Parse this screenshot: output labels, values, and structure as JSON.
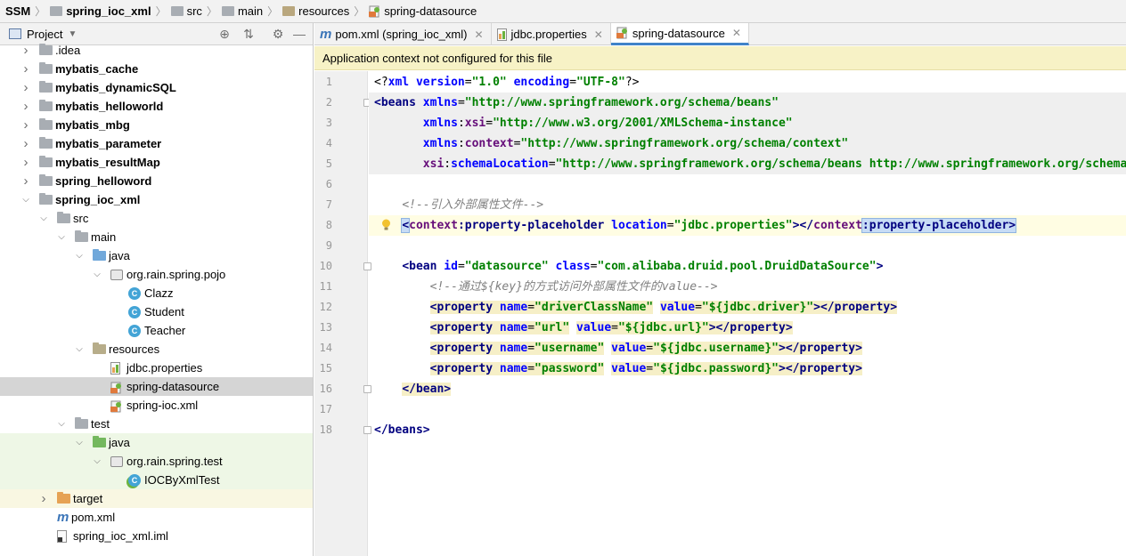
{
  "breadcrumb": {
    "items": [
      "SSM",
      "spring_ioc_xml",
      "src",
      "main",
      "resources",
      "spring-datasource"
    ]
  },
  "project_panel": {
    "title": "Project",
    "header_icons": [
      "target-icon",
      "collapse-icon",
      "gear-icon",
      "minimize-icon"
    ],
    "tree": [
      {
        "label": ".idea",
        "level": 1,
        "arrow": "collapsed",
        "icon": "folder",
        "bold": false
      },
      {
        "label": "mybatis_cache",
        "level": 1,
        "arrow": "collapsed",
        "icon": "module-folder",
        "bold": true
      },
      {
        "label": "mybatis_dynamicSQL",
        "level": 1,
        "arrow": "collapsed",
        "icon": "module-folder",
        "bold": true
      },
      {
        "label": "mybatis_helloworld",
        "level": 1,
        "arrow": "collapsed",
        "icon": "module-folder",
        "bold": true
      },
      {
        "label": "mybatis_mbg",
        "level": 1,
        "arrow": "collapsed",
        "icon": "module-folder",
        "bold": true
      },
      {
        "label": "mybatis_parameter",
        "level": 1,
        "arrow": "collapsed",
        "icon": "module-folder",
        "bold": true
      },
      {
        "label": "mybatis_resultMap",
        "level": 1,
        "arrow": "collapsed",
        "icon": "module-folder",
        "bold": true
      },
      {
        "label": "spring_helloword",
        "level": 1,
        "arrow": "collapsed",
        "icon": "module-folder",
        "bold": true
      },
      {
        "label": "spring_ioc_xml",
        "level": 1,
        "arrow": "expanded",
        "icon": "module-folder",
        "bold": true
      },
      {
        "label": "src",
        "level": 2,
        "arrow": "expanded",
        "icon": "folder",
        "bold": false
      },
      {
        "label": "main",
        "level": 3,
        "arrow": "expanded",
        "icon": "folder",
        "bold": false
      },
      {
        "label": "java",
        "level": 4,
        "arrow": "expanded",
        "icon": "source-folder",
        "bold": false
      },
      {
        "label": "org.rain.spring.pojo",
        "level": 5,
        "arrow": "expanded",
        "icon": "package",
        "bold": false
      },
      {
        "label": "Clazz",
        "level": 6,
        "arrow": "none",
        "icon": "class",
        "bold": false
      },
      {
        "label": "Student",
        "level": 6,
        "arrow": "none",
        "icon": "class",
        "bold": false
      },
      {
        "label": "Teacher",
        "level": 6,
        "arrow": "none",
        "icon": "class",
        "bold": false
      },
      {
        "label": "resources",
        "level": 4,
        "arrow": "expanded",
        "icon": "resources-folder",
        "bold": false
      },
      {
        "label": "jdbc.properties",
        "level": 5,
        "arrow": "none",
        "icon": "properties-file",
        "bold": false
      },
      {
        "label": "spring-datasource",
        "level": 5,
        "arrow": "none",
        "icon": "spring-xml",
        "bold": false,
        "selected": true
      },
      {
        "label": "spring-ioc.xml",
        "level": 5,
        "arrow": "none",
        "icon": "spring-xml",
        "bold": false
      },
      {
        "label": "test",
        "level": 3,
        "arrow": "expanded",
        "icon": "folder",
        "bold": false
      },
      {
        "label": "java",
        "level": 4,
        "arrow": "expanded",
        "icon": "test-folder",
        "bold": false,
        "test": true
      },
      {
        "label": "org.rain.spring.test",
        "level": 5,
        "arrow": "expanded",
        "icon": "package",
        "bold": false,
        "test": true
      },
      {
        "label": "IOCByXmlTest",
        "level": 6,
        "arrow": "none",
        "icon": "test-class",
        "bold": false,
        "test": true
      },
      {
        "label": "target",
        "level": 2,
        "arrow": "collapsed",
        "icon": "excluded-folder",
        "bold": false,
        "target": true
      },
      {
        "label": "pom.xml",
        "level": 2,
        "arrow": "none",
        "icon": "maven",
        "bold": false
      },
      {
        "label": "spring_ioc_xml.iml",
        "level": 2,
        "arrow": "none",
        "icon": "iml-file",
        "bold": false
      }
    ]
  },
  "editor": {
    "tabs": [
      {
        "label": "pom.xml (spring_ioc_xml)",
        "icon": "maven-icon",
        "active": false
      },
      {
        "label": "jdbc.properties",
        "icon": "properties-file-icon",
        "active": false
      },
      {
        "label": "spring-datasource",
        "icon": "spring-xml-icon",
        "active": true
      }
    ],
    "banner": "Application context not configured for this file",
    "line_numbers": [
      "1",
      "2",
      "3",
      "4",
      "5",
      "6",
      "7",
      "8",
      "9",
      "10",
      "11",
      "12",
      "13",
      "14",
      "15",
      "16",
      "17",
      "18"
    ],
    "lines": [
      [
        [
          "plain",
          "<?"
        ],
        [
          "attr",
          "xml "
        ],
        [
          "attr",
          "version"
        ],
        [
          "plain",
          "="
        ],
        [
          "val",
          "\"1.0\""
        ],
        [
          "plain",
          " "
        ],
        [
          "attr",
          "encoding"
        ],
        [
          "plain",
          "="
        ],
        [
          "val",
          "\"UTF-8\""
        ],
        [
          "plain",
          "?>"
        ]
      ],
      [
        [
          "tag",
          "<beans "
        ],
        [
          "attr",
          "xmlns"
        ],
        [
          "plain",
          "="
        ],
        [
          "val",
          "\"http://www.springframework.org/schema/beans\""
        ]
      ],
      [
        [
          "plain",
          "       "
        ],
        [
          "attr",
          "xmlns"
        ],
        [
          "plain",
          ":"
        ],
        [
          "ns",
          "xsi"
        ],
        [
          "plain",
          "="
        ],
        [
          "val",
          "\"http://www.w3.org/2001/XMLSchema-instance\""
        ]
      ],
      [
        [
          "plain",
          "       "
        ],
        [
          "attr",
          "xmlns"
        ],
        [
          "plain",
          ":"
        ],
        [
          "ns",
          "context"
        ],
        [
          "plain",
          "="
        ],
        [
          "val",
          "\"http://www.springframework.org/schema/context\""
        ]
      ],
      [
        [
          "plain",
          "       "
        ],
        [
          "ns",
          "xsi"
        ],
        [
          "plain",
          ":"
        ],
        [
          "attr",
          "schemaLocation"
        ],
        [
          "plain",
          "="
        ],
        [
          "val",
          "\"http://www.springframework.org/schema/beans http://www.springframework.org/schema/beans/spring-beans.xsd\""
        ]
      ],
      [],
      [
        [
          "plain",
          "    "
        ],
        [
          "cmt",
          "<!--引入外部属性文件-->"
        ]
      ],
      [
        [
          "plain",
          "    "
        ],
        [
          "tag",
          "<"
        ],
        [
          "ns",
          "context"
        ],
        [
          "tag",
          ":property-placeholder "
        ],
        [
          "attr",
          "location"
        ],
        [
          "plain",
          "="
        ],
        [
          "val",
          "\"jdbc.properties\""
        ],
        [
          "tag",
          "></"
        ],
        [
          "ns",
          "context"
        ],
        [
          "tag",
          ":property-placeholder>"
        ]
      ],
      [],
      [
        [
          "plain",
          "    "
        ],
        [
          "tag",
          "<bean "
        ],
        [
          "attr",
          "id"
        ],
        [
          "plain",
          "="
        ],
        [
          "val",
          "\"datasource\""
        ],
        [
          "plain",
          " "
        ],
        [
          "attr",
          "class"
        ],
        [
          "plain",
          "="
        ],
        [
          "val",
          "\"com.alibaba.druid.pool.DruidDataSource\""
        ],
        [
          "tag",
          ">"
        ]
      ],
      [
        [
          "plain",
          "        "
        ],
        [
          "cmt",
          "<!--通过${key}的方式访问外部属性文件的value-->"
        ]
      ],
      [
        [
          "plain",
          "        "
        ],
        [
          "tag",
          "<property "
        ],
        [
          "attr",
          "name"
        ],
        [
          "plain",
          "="
        ],
        [
          "val",
          "\"driverClassName\""
        ],
        [
          "plain",
          " "
        ],
        [
          "attr",
          "value"
        ],
        [
          "plain",
          "="
        ],
        [
          "val",
          "\"${jdbc.driver}\""
        ],
        [
          "tag",
          "></property>"
        ]
      ],
      [
        [
          "plain",
          "        "
        ],
        [
          "tag",
          "<property "
        ],
        [
          "attr",
          "name"
        ],
        [
          "plain",
          "="
        ],
        [
          "val",
          "\"url\""
        ],
        [
          "plain",
          " "
        ],
        [
          "attr",
          "value"
        ],
        [
          "plain",
          "="
        ],
        [
          "val",
          "\"${jdbc.url}\""
        ],
        [
          "tag",
          "></property>"
        ]
      ],
      [
        [
          "plain",
          "        "
        ],
        [
          "tag",
          "<property "
        ],
        [
          "attr",
          "name"
        ],
        [
          "plain",
          "="
        ],
        [
          "val",
          "\"username\""
        ],
        [
          "plain",
          " "
        ],
        [
          "attr",
          "value"
        ],
        [
          "plain",
          "="
        ],
        [
          "val",
          "\"${jdbc.username}\""
        ],
        [
          "tag",
          "></property>"
        ]
      ],
      [
        [
          "plain",
          "        "
        ],
        [
          "tag",
          "<property "
        ],
        [
          "attr",
          "name"
        ],
        [
          "plain",
          "="
        ],
        [
          "val",
          "\"password\""
        ],
        [
          "plain",
          " "
        ],
        [
          "attr",
          "value"
        ],
        [
          "plain",
          "="
        ],
        [
          "val",
          "\"${jdbc.password}\""
        ],
        [
          "tag",
          "></property>"
        ]
      ],
      [
        [
          "plain",
          "    "
        ],
        [
          "tag",
          "</bean>"
        ]
      ],
      [],
      [
        [
          "tag",
          "</beans>"
        ]
      ]
    ]
  }
}
